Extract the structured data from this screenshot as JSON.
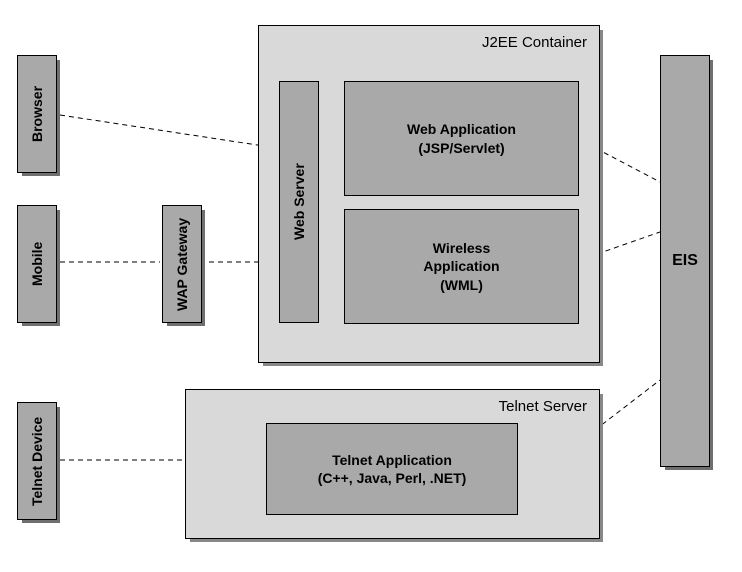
{
  "clients": {
    "browser": "Browser",
    "mobile": "Mobile",
    "telnet_device": "Telnet Device"
  },
  "gateway": {
    "wap": "WAP Gateway"
  },
  "j2ee": {
    "container_label": "J2EE Container",
    "web_server": "Web Server",
    "web_app_title": "Web Application",
    "web_app_sub": "(JSP/Servlet)",
    "wireless_app_title": "Wireless",
    "wireless_app_title2": "Application",
    "wireless_app_sub": "(WML)"
  },
  "telnet": {
    "container_label": "Telnet Server",
    "app_title": "Telnet Application",
    "app_sub": "(C++, Java, Perl, .NET)"
  },
  "eis": "EIS"
}
